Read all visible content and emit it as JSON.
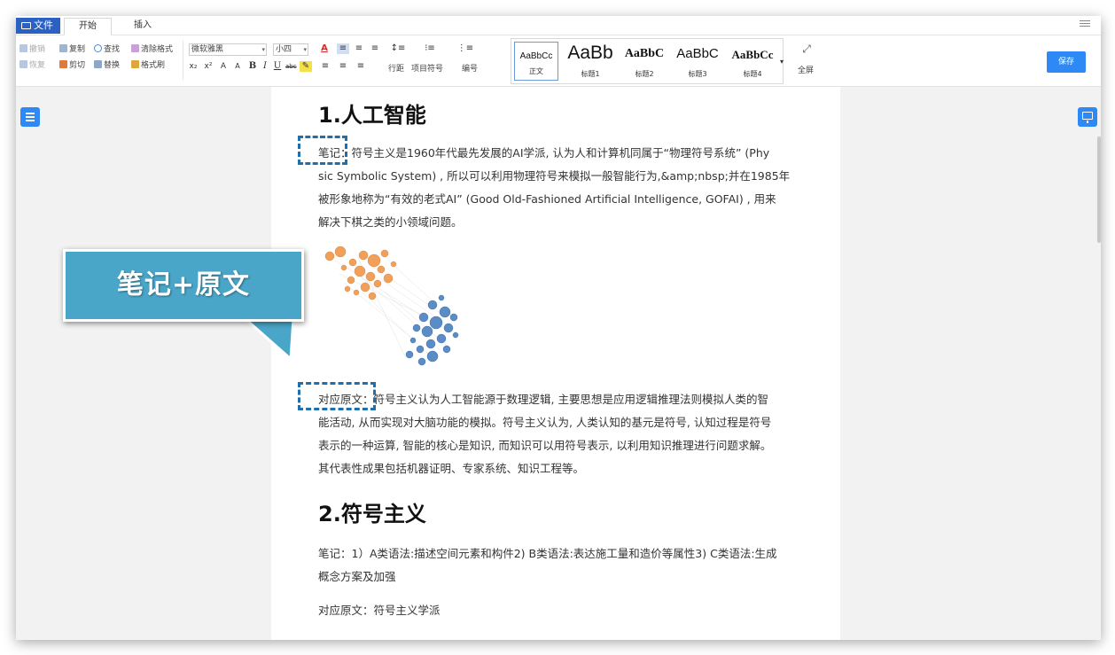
{
  "tabs": {
    "file": "文件",
    "home": "开始",
    "insert": "插入"
  },
  "toolbar": {
    "undo": "撤销",
    "redo": "恢复",
    "copy": "复制",
    "cut": "剪切",
    "find": "查找",
    "replace": "替换",
    "clear_format": "清除格式",
    "format_painter": "格式刷",
    "font_family": "微软雅黑",
    "font_size": "小四",
    "line_spacing": "行距",
    "bullets": "项目符号",
    "numbering": "编号",
    "fullscreen": "全屏",
    "save": "保存",
    "styles": [
      {
        "preview": "AaBbCc",
        "label": "正文"
      },
      {
        "preview": "AaBb",
        "label": "标题1"
      },
      {
        "preview": "AaBbC",
        "label": "标题2"
      },
      {
        "preview": "AaBbC",
        "label": "标题3"
      },
      {
        "preview": "AaBbCc",
        "label": "标题4"
      }
    ]
  },
  "document": {
    "heading1": "1.人工智能",
    "note1_lines": [
      "笔记：符号主义是1960年代最先发展的AI学派, 认为人和计算机同属于“物理符号系统” (Phy",
      "sic Symbolic System) , 所以可以利用物理符号来模拟一般智能行为,&amp;nbsp;并在1985年",
      "被形象地称为“有效的老式AI” (Good Old-Fashioned Artificial Intelligence, GOFAI) , 用来",
      "解决下棋之类的小领域问题。"
    ],
    "orig1_lines": [
      "对应原文：符号主义认为人工智能源于数理逻辑, 主要思想是应用逻辑推理法则模拟人类的智",
      "能活动, 从而实现对大脑功能的模拟。符号主义认为, 人类认知的基元是符号, 认知过程是符号",
      "表示的一种运算, 智能的核心是知识, 而知识可以用符号表示, 以利用知识推理进行问题求解。",
      "其代表性成果包括机器证明、专家系统、知识工程等。"
    ],
    "heading2": "2.符号主义",
    "note2_lines": [
      "笔记：1）A类语法:描述空间元素和构件2) B类语法:表达施工量和造价等属性3) C类语法:生成",
      "概念方案及加强"
    ],
    "orig2": "对应原文：符号主义学派"
  },
  "callout": {
    "text": "笔记+原文"
  },
  "colors": {
    "accent": "#2f89f5",
    "file_tab": "#2b62c2",
    "callout": "#4aa6c8",
    "dash": "#1f6fad"
  }
}
